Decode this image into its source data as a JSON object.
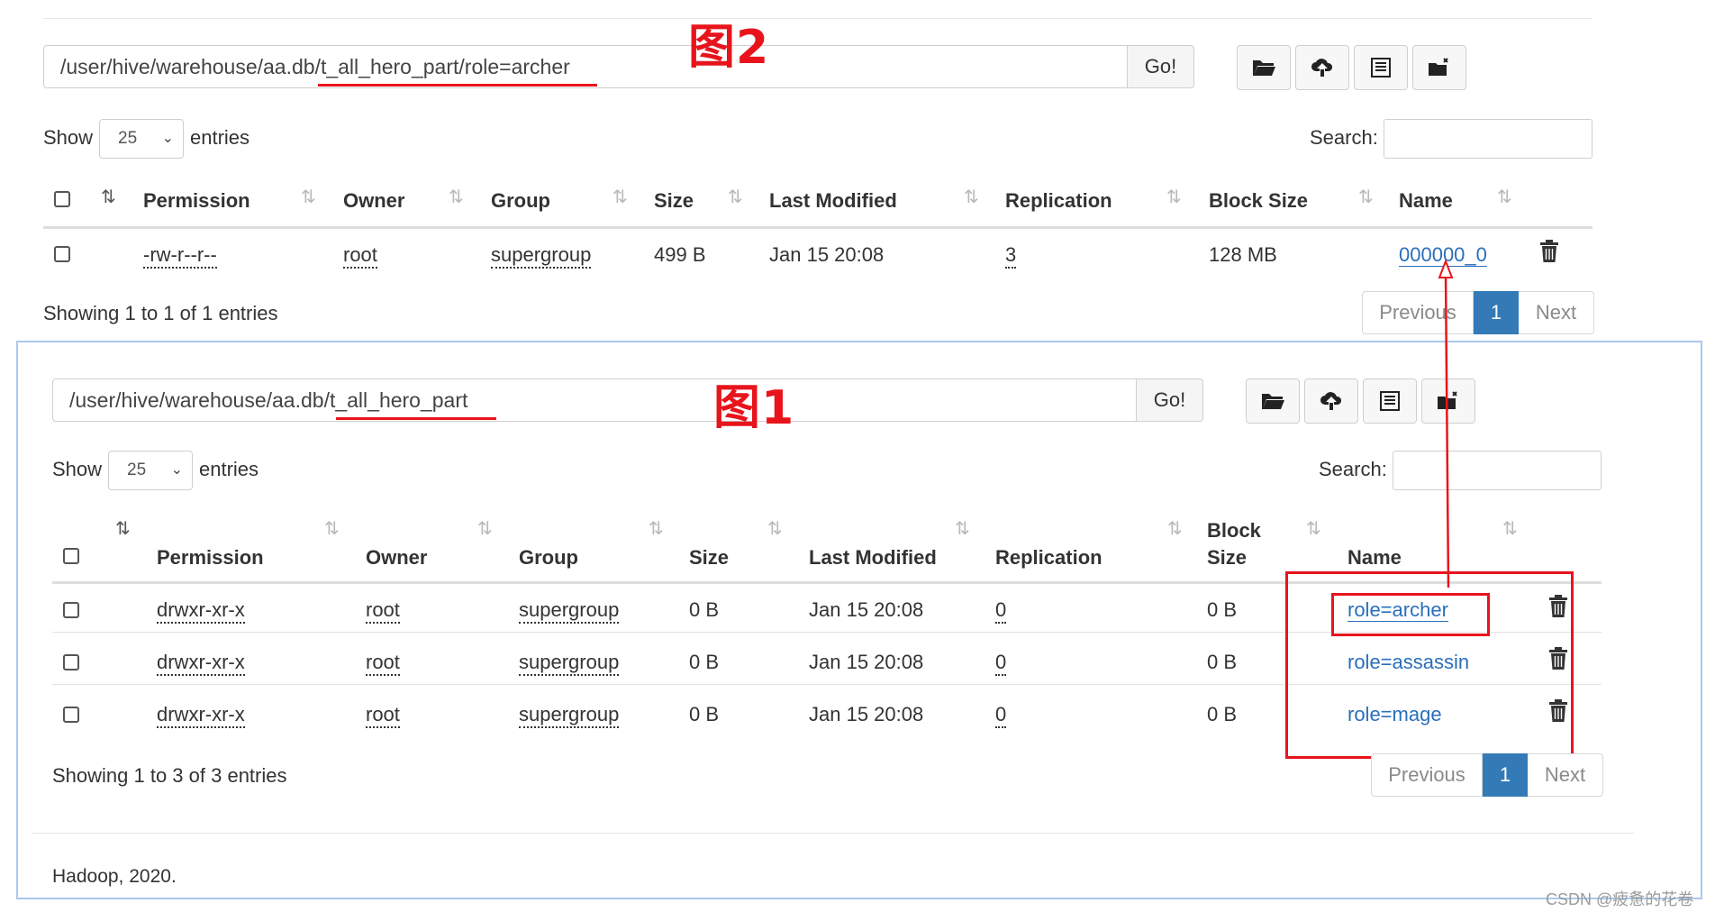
{
  "panel2": {
    "label": "图2",
    "path": "/user/hive/warehouse/aa.db/t_all_hero_part/role=archer",
    "go_label": "Go!",
    "toolbar_icons": [
      "folder-open-icon",
      "cloud-upload-icon",
      "list-icon",
      "folder-cut-icon"
    ],
    "show_label": "Show",
    "entries_value": "25",
    "entries_label": "entries",
    "search_label": "Search:",
    "search_value": "",
    "columns": [
      "Permission",
      "Owner",
      "Group",
      "Size",
      "Last Modified",
      "Replication",
      "Block Size",
      "Name"
    ],
    "rows": [
      {
        "permission": "-rw-r--r--",
        "owner": "root",
        "group": "supergroup",
        "size": "499 B",
        "modified": "Jan 15 20:08",
        "replication": "3",
        "block_size": "128 MB",
        "name": "000000_0"
      }
    ],
    "info": "Showing 1 to 1 of 1 entries",
    "pager": {
      "prev": "Previous",
      "page": "1",
      "next": "Next"
    }
  },
  "panel1": {
    "label": "图1",
    "path": "/user/hive/warehouse/aa.db/t_all_hero_part",
    "go_label": "Go!",
    "toolbar_icons": [
      "folder-open-icon",
      "cloud-upload-icon",
      "list-icon",
      "folder-cut-icon"
    ],
    "show_label": "Show",
    "entries_value": "25",
    "entries_label": "entries",
    "search_label": "Search:",
    "search_value": "",
    "columns": [
      "Permission",
      "Owner",
      "Group",
      "Size",
      "Last Modified",
      "Replication",
      "Block",
      "Size",
      "Name"
    ],
    "rows": [
      {
        "permission": "drwxr-xr-x",
        "owner": "root",
        "group": "supergroup",
        "size": "0 B",
        "modified": "Jan 15 20:08",
        "replication": "0",
        "block_size": "0 B",
        "name": "role=archer"
      },
      {
        "permission": "drwxr-xr-x",
        "owner": "root",
        "group": "supergroup",
        "size": "0 B",
        "modified": "Jan 15 20:08",
        "replication": "0",
        "block_size": "0 B",
        "name": "role=assassin"
      },
      {
        "permission": "drwxr-xr-x",
        "owner": "root",
        "group": "supergroup",
        "size": "0 B",
        "modified": "Jan 15 20:08",
        "replication": "0",
        "block_size": "0 B",
        "name": "role=mage"
      }
    ],
    "info": "Showing 1 to 3 of 3 entries",
    "pager": {
      "prev": "Previous",
      "page": "1",
      "next": "Next"
    },
    "footer": "Hadoop, 2020."
  },
  "watermark": "CSDN @疲惫的花卷",
  "colors": {
    "accent": "#337ab7",
    "link": "#2a6fbb",
    "annotation": "#e8141c",
    "panel_border": "#a9c9ee"
  }
}
